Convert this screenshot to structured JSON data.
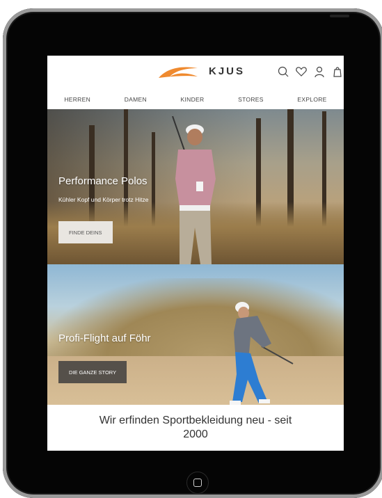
{
  "brand": {
    "name": "KJUS"
  },
  "nav": {
    "items": [
      "HERREN",
      "DAMEN",
      "KINDER",
      "STORES",
      "EXPLORE"
    ]
  },
  "icons": [
    "search-icon",
    "heart-icon",
    "user-icon",
    "bag-icon"
  ],
  "hero1": {
    "title": "Performance Polos",
    "subtitle": "Kühler Kopf und Körper trotz Hitze",
    "button": "FINDE DEINS"
  },
  "hero2": {
    "title": "Profi-Flight auf Föhr",
    "button": "DIE GANZE STORY"
  },
  "tagline": {
    "line1": "Wir erfinden Sportbekleidung neu - seit",
    "line2": "2000"
  },
  "colors": {
    "accent": "#ef8a2f",
    "dark_button": "#55504a",
    "light_button": "#e9e6e1"
  }
}
